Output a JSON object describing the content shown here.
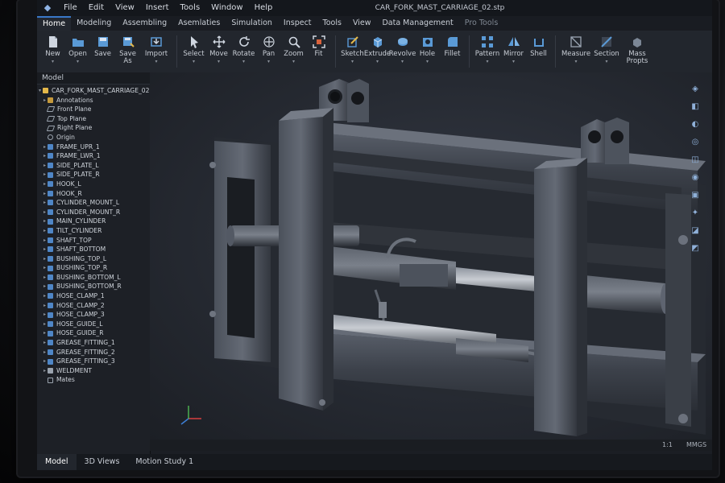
{
  "menu": {
    "items": [
      "File",
      "Edit",
      "View",
      "Insert",
      "Tools",
      "Window",
      "Help"
    ],
    "title": "CAR_FORK_MAST_CARRIAGE_02.stp"
  },
  "tabs": [
    "Home",
    "Modeling",
    "Assembling",
    "Asemlaties",
    "Simulation",
    "Inspect",
    "Tools",
    "View",
    "Data Management",
    "Pro Tools"
  ],
  "active_tab": "Home",
  "ribbon": {
    "file": [
      {
        "label": "New",
        "icon": "new-file-icon"
      },
      {
        "label": "Open",
        "icon": "folder-open-icon"
      },
      {
        "label": "Save",
        "icon": "save-icon"
      },
      {
        "label": "Save As",
        "icon": "save-as-icon"
      },
      {
        "label": "Import",
        "icon": "import-icon"
      }
    ],
    "navigate": [
      {
        "label": "Select",
        "icon": "cursor-icon"
      },
      {
        "label": "Move",
        "icon": "move-icon"
      },
      {
        "label": "Rotate",
        "icon": "rotate-icon"
      },
      {
        "label": "Pan",
        "icon": "pan-icon"
      },
      {
        "label": "Zoom",
        "icon": "zoom-icon"
      },
      {
        "label": "Fit",
        "icon": "fit-icon"
      }
    ],
    "create": [
      {
        "label": "Sketch",
        "icon": "sketch-icon"
      },
      {
        "label": "Extrude",
        "icon": "extrude-icon"
      },
      {
        "label": "Revolve",
        "icon": "revolve-icon"
      },
      {
        "label": "Hole",
        "icon": "hole-icon"
      },
      {
        "label": "Fillet",
        "icon": "fillet-icon"
      }
    ],
    "pattern": [
      {
        "label": "Pattern",
        "icon": "pattern-icon"
      },
      {
        "label": "Mirror",
        "icon": "mirror-icon"
      },
      {
        "label": "Shell",
        "icon": "shell-icon"
      }
    ],
    "analyze": [
      {
        "label": "Measure",
        "icon": "measure-icon"
      },
      {
        "label": "Section",
        "icon": "section-icon"
      },
      {
        "label": "Mass Propts",
        "icon": "mass-props-icon"
      }
    ]
  },
  "tree": {
    "header": "Model",
    "root": "CAR_FORK_MAST_CARRIAGE_02",
    "items": [
      {
        "label": "Annotations",
        "type": "folder",
        "expand": true
      },
      {
        "label": "Front Plane",
        "type": "plane",
        "expand": false
      },
      {
        "label": "Top Plane",
        "type": "plane",
        "expand": false
      },
      {
        "label": "Right Plane",
        "type": "plane",
        "expand": false
      },
      {
        "label": "Origin",
        "type": "origin",
        "expand": false
      },
      {
        "label": "FRAME_UPR_1",
        "type": "part",
        "expand": true
      },
      {
        "label": "FRAME_LWR_1",
        "type": "part",
        "expand": true
      },
      {
        "label": "SIDE_PLATE_L",
        "type": "part",
        "expand": true
      },
      {
        "label": "SIDE_PLATE_R",
        "type": "part",
        "expand": true
      },
      {
        "label": "HOOK_L",
        "type": "part",
        "expand": true
      },
      {
        "label": "HOOK_R",
        "type": "part",
        "expand": true
      },
      {
        "label": "CYLINDER_MOUNT_L",
        "type": "part",
        "expand": true
      },
      {
        "label": "CYLINDER_MOUNT_R",
        "type": "part",
        "expand": true
      },
      {
        "label": "MAIN_CYLINDER",
        "type": "part",
        "expand": true
      },
      {
        "label": "TILT_CYLINDER",
        "type": "part",
        "expand": true
      },
      {
        "label": "SHAFT_TOP",
        "type": "part",
        "expand": true
      },
      {
        "label": "SHAFT_BOTTOM",
        "type": "part",
        "expand": true
      },
      {
        "label": "BUSHING_TOP_L",
        "type": "part",
        "expand": true
      },
      {
        "label": "BUSHING_TOP_R",
        "type": "part",
        "expand": true
      },
      {
        "label": "BUSHING_BOTTOM_L",
        "type": "part",
        "expand": true
      },
      {
        "label": "BUSHING_BOTTOM_R",
        "type": "part",
        "expand": true
      },
      {
        "label": "HOSE_CLAMP_1",
        "type": "part",
        "expand": true
      },
      {
        "label": "HOSE_CLAMP_2",
        "type": "part",
        "expand": true
      },
      {
        "label": "HOSE_CLAMP_3",
        "type": "part",
        "expand": true
      },
      {
        "label": "HOSE_GUIDE_L",
        "type": "part",
        "expand": true
      },
      {
        "label": "HOSE_GUIDE_R",
        "type": "part",
        "expand": true
      },
      {
        "label": "GREASE_FITTING_1",
        "type": "part",
        "expand": true
      },
      {
        "label": "GREASE_FITTING_2",
        "type": "part",
        "expand": true
      },
      {
        "label": "GREASE_FITTING_3",
        "type": "part",
        "expand": true
      },
      {
        "label": "WELDMENT",
        "type": "weld",
        "expand": true
      },
      {
        "label": "Mates",
        "type": "mate",
        "expand": false
      }
    ]
  },
  "status": {
    "scale": "1:1",
    "units": "MMGS"
  },
  "bottom_tabs": [
    "Model",
    "3D Views",
    "Motion Study 1"
  ],
  "active_bottom_tab": "Model",
  "colors": {
    "accent": "#3a78c8",
    "part_icon": "#4f86c6",
    "folder_icon": "#c69a3c"
  }
}
